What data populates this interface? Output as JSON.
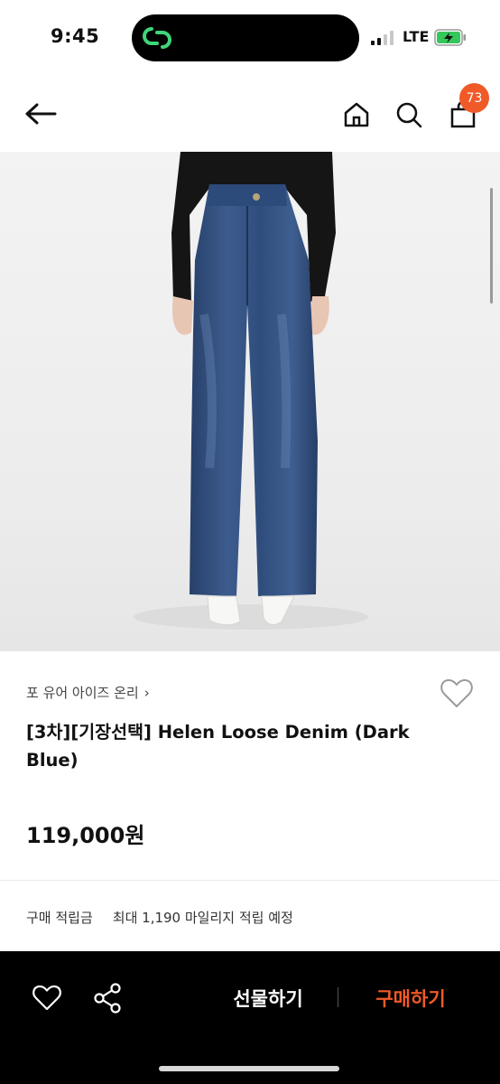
{
  "status_bar": {
    "time": "9:45",
    "network": "LTE"
  },
  "header": {
    "cart_badge": "73"
  },
  "product": {
    "brand": "포 유어 아이즈 온리",
    "brand_chevron": "›",
    "title": "[3차][기장선택] Helen Loose Denim (Dark Blue)",
    "price": "119,000원"
  },
  "points": {
    "label": "구매 적립금",
    "value": "최대 1,190 마일리지 적립 예정"
  },
  "bottom_bar": {
    "gift_label": "선물하기",
    "buy_label": "구매하기"
  },
  "colors": {
    "accent": "#f05a28",
    "bar": "#000000",
    "island_app": "#3fd67a"
  }
}
